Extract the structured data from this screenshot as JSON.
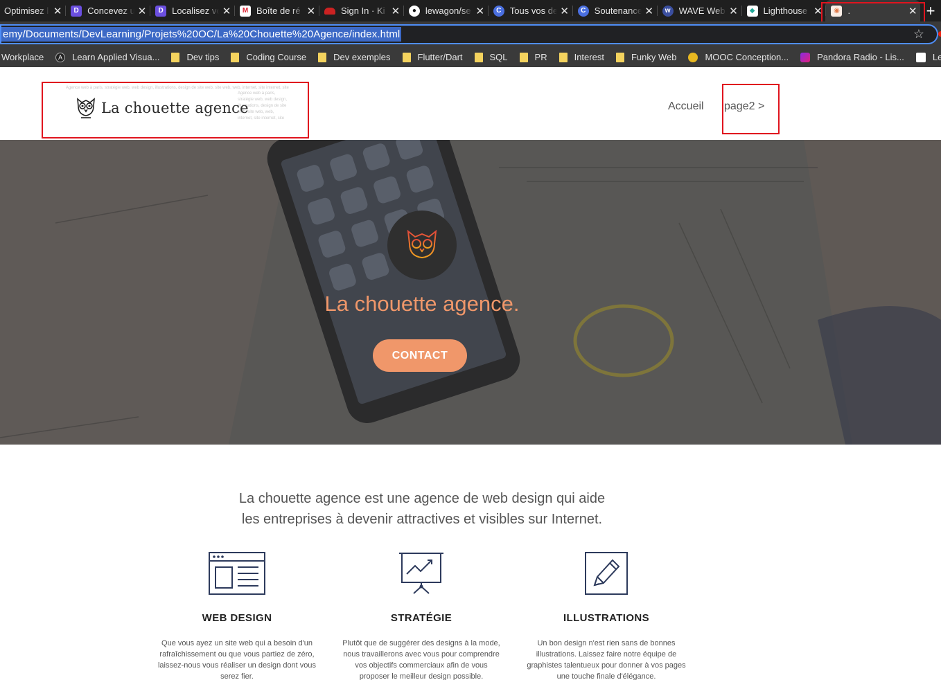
{
  "browser": {
    "tabs": [
      {
        "title": "Optimisez l",
        "favicon": "none"
      },
      {
        "title": "Concevez u",
        "favicon": "purple-d-icon"
      },
      {
        "title": "Localisez vo",
        "favicon": "purple-d-icon"
      },
      {
        "title": "Boîte de ré",
        "favicon": "gmail-icon"
      },
      {
        "title": "Sign In · Ki",
        "favicon": "car-icon"
      },
      {
        "title": "lewagon/se",
        "favicon": "github-icon"
      },
      {
        "title": "Tous vos de",
        "favicon": "c-icon"
      },
      {
        "title": "Soutenance",
        "favicon": "c-icon"
      },
      {
        "title": "WAVE Web",
        "favicon": "wave-icon"
      },
      {
        "title": "Lighthouse",
        "favicon": "lighthouse-icon"
      },
      {
        "title": ".",
        "favicon": "owl-icon",
        "active": true
      }
    ],
    "url": "emy/Documents/DevLearning/Projets%20OC/La%20Chouette%20Agence/index.html",
    "bookmarks": [
      {
        "label": "Workplace",
        "icon": "none"
      },
      {
        "label": "Learn Applied Visua...",
        "icon": "A-icon"
      },
      {
        "label": "Dev tips",
        "icon": "folder-icon"
      },
      {
        "label": "Coding Course",
        "icon": "folder-icon"
      },
      {
        "label": "Dev exemples",
        "icon": "folder-icon"
      },
      {
        "label": "Flutter/Dart",
        "icon": "folder-icon"
      },
      {
        "label": "SQL",
        "icon": "folder-icon"
      },
      {
        "label": "PR",
        "icon": "folder-icon"
      },
      {
        "label": "Interest",
        "icon": "folder-icon"
      },
      {
        "label": "Funky Web",
        "icon": "folder-icon"
      },
      {
        "label": "MOOC Conception...",
        "icon": "yellow-badge-icon"
      },
      {
        "label": "Pandora Radio - Lis...",
        "icon": "pandora-icon"
      },
      {
        "label": "Le guide des Aide",
        "icon": "guide-icon"
      }
    ]
  },
  "header": {
    "seo_text_main": "Agence web à paris, stratégie web, web design, illustrations, design de site web, site web, web, internet, site internet, site",
    "seo_text_col": "Agence web à paris, stratégie web, web design, illustrations, design de site web, site web, web, internet, site internet, site",
    "logo_text": "La chouette agence",
    "nav": {
      "home": "Accueil",
      "page2": "page2 >"
    }
  },
  "hero": {
    "title": "La chouette agence.",
    "contact_label": "CONTACT"
  },
  "intro": {
    "line1": "La chouette agence est une agence de web design qui aide",
    "line2": "les entreprises à devenir attractives et visibles sur Internet."
  },
  "services": [
    {
      "title": "WEB DESIGN",
      "icon": "web-design-icon",
      "text": "Que vous ayez un site web qui a besoin d'un rafraîchissement ou que vous partiez de zéro, laissez-nous vous réaliser un design dont vous serez fier."
    },
    {
      "title": "STRATÉGIE",
      "icon": "strategy-icon",
      "text": "Plutôt que de suggérer des designs à la mode, nous travaillerons avec vous pour comprendre vos objectifs commerciaux afin de vous proposer le meilleur design possible."
    },
    {
      "title": "ILLUSTRATIONS",
      "icon": "illustration-icon",
      "text": "Un bon design n'est rien sans de bonnes illustrations. Laissez faire notre équipe de graphistes talentueux pour donner à vos pages une touche finale d'élégance."
    }
  ],
  "colors": {
    "accent": "#f0976a",
    "highlight_box": "#e0141e",
    "icon_navy": "#2d3a5c"
  }
}
